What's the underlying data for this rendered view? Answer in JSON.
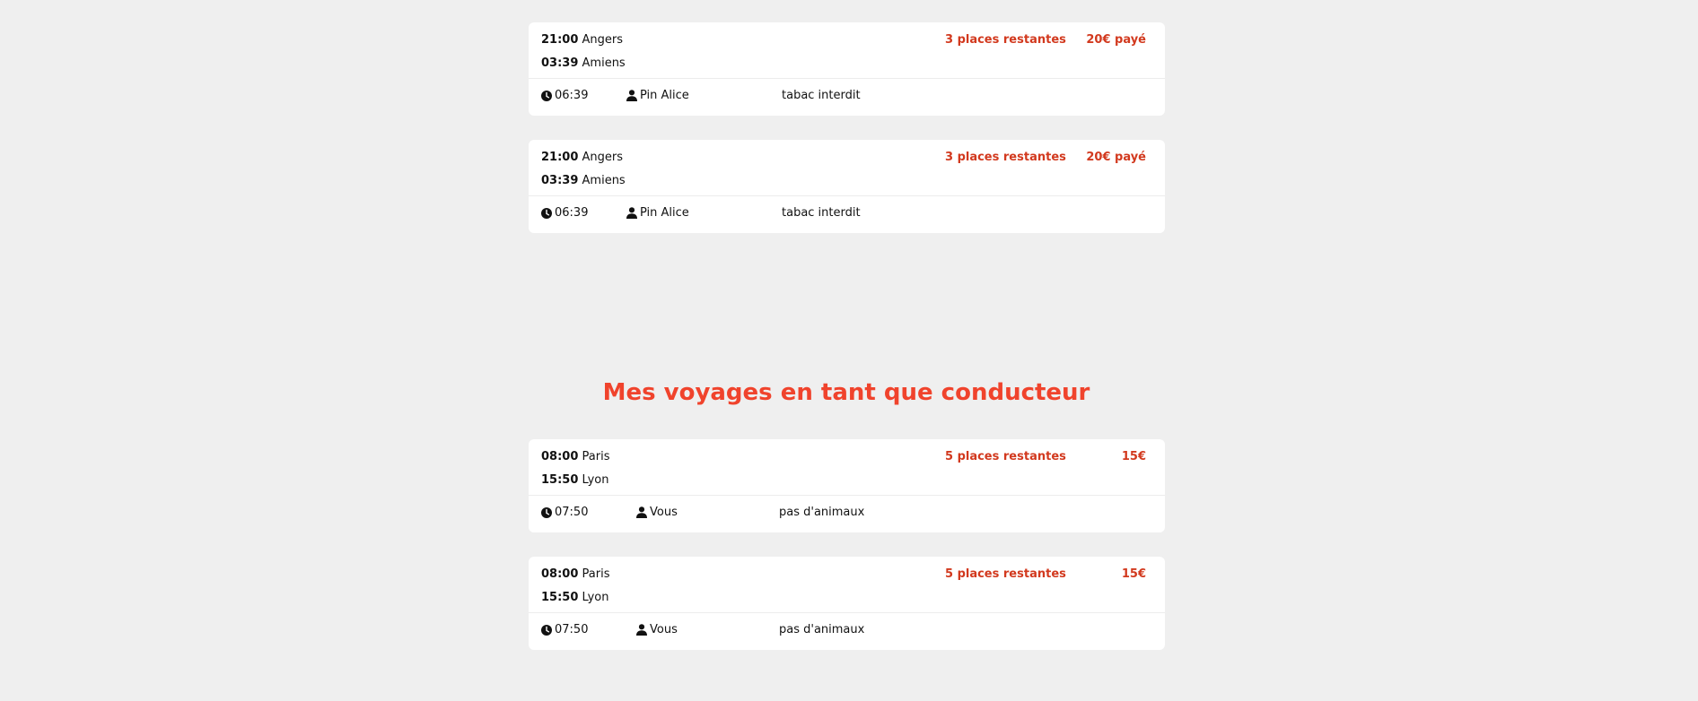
{
  "passenger_trips": [
    {
      "dep_time": "21:00",
      "dep_city": "Angers",
      "arr_time": "03:39",
      "arr_city": "Amiens",
      "seats": "3 places restantes",
      "price": "20€ payé",
      "duration": "06:39",
      "driver": "Pin Alice",
      "rule": "tabac interdit"
    },
    {
      "dep_time": "21:00",
      "dep_city": "Angers",
      "arr_time": "03:39",
      "arr_city": "Amiens",
      "seats": "3 places restantes",
      "price": "20€ payé",
      "duration": "06:39",
      "driver": "Pin Alice",
      "rule": "tabac interdit"
    }
  ],
  "driver_section": {
    "title": "Mes voyages en tant que conducteur"
  },
  "driver_trips": [
    {
      "dep_time": "08:00",
      "dep_city": "Paris",
      "arr_time": "15:50",
      "arr_city": "Lyon",
      "seats": "5 places restantes",
      "price": "15€",
      "duration": "07:50",
      "driver": "Vous",
      "rule": "pas d'animaux"
    },
    {
      "dep_time": "08:00",
      "dep_city": "Paris",
      "arr_time": "15:50",
      "arr_city": "Lyon",
      "seats": "5 places restantes",
      "price": "15€",
      "duration": "07:50",
      "driver": "Vous",
      "rule": "pas d'animaux"
    }
  ],
  "colors": {
    "accent": "#d2391e",
    "title": "#f0432c",
    "background": "#efefef"
  },
  "icons": {
    "duration": "clock-icon",
    "driver": "user-icon"
  }
}
